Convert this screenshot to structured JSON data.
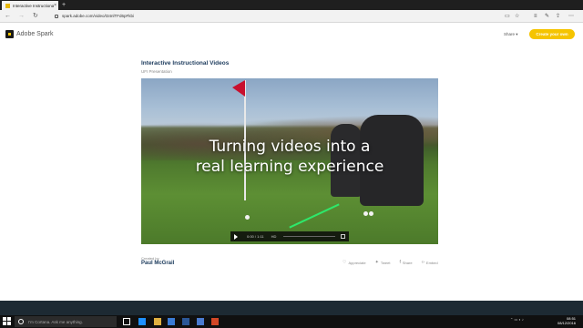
{
  "browser": {
    "tab_title": "Interactive Instructional",
    "tab_close": "×",
    "new_tab": "+",
    "url": "spark.adobe.com/video/t34nlTFd6pFkbi",
    "back": "←",
    "forward": "→",
    "refresh": "↻"
  },
  "header": {
    "logo_text": "Adobe Spark",
    "share_label": "Share ▾",
    "create_label": "Create your own"
  },
  "content": {
    "title": "Interactive Instructional Videos",
    "subtitle": "UFI Presentation",
    "video_caption_line1": "Turning videos into a",
    "video_caption_line2": "real learning experience",
    "time_current": "0:00 / 1:11",
    "time_hd": "HD",
    "created_label": "Created by",
    "author": "Paul McGrail",
    "actions": {
      "appreciate": "Appreciate",
      "tweet": "Tweet",
      "share": "Share",
      "embed": "Embed"
    }
  },
  "taskbar": {
    "cortana_text": "I'm Cortana. Ask me anything.",
    "time": "08:51",
    "date": "08/12/2016"
  },
  "colors": {
    "accent": "#f5c400",
    "title": "#1b3a5c",
    "flag": "#c8102e"
  }
}
